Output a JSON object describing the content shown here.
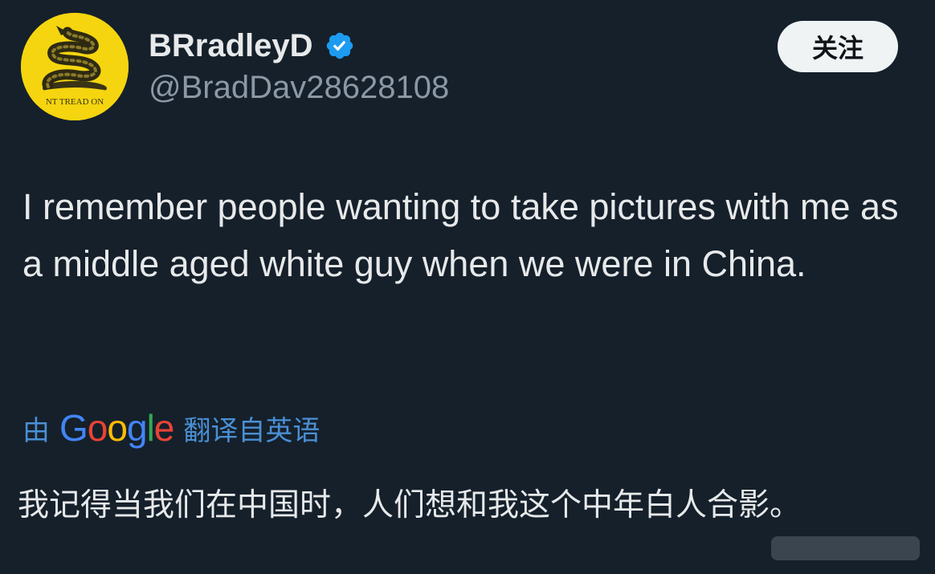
{
  "user": {
    "display_name": "BRradleyD",
    "handle": "@BradDav28628108",
    "avatar_text": "NT TREAD ON",
    "verified_icon": "verified-badge-icon"
  },
  "actions": {
    "follow_label": "关注"
  },
  "tweet": {
    "text": "I remember people wanting to take pictures with me as a middle aged white guy when we were in China."
  },
  "translation": {
    "prefix": "由",
    "brand": [
      "G",
      "o",
      "o",
      "g",
      "l",
      "e"
    ],
    "suffix": "翻译自英语",
    "text": "我记得当我们在中国时，人们想和我这个中年白人合影。"
  },
  "colors": {
    "background": "#15202b",
    "text": "#e7e9ea",
    "secondary_text": "#8b98a5",
    "verified": "#1d9bf0",
    "translate_link": "#4a8fd4",
    "google_blue": "#4285f4",
    "google_red": "#ea4335",
    "google_yellow": "#fbbc05",
    "google_green": "#34a853"
  }
}
